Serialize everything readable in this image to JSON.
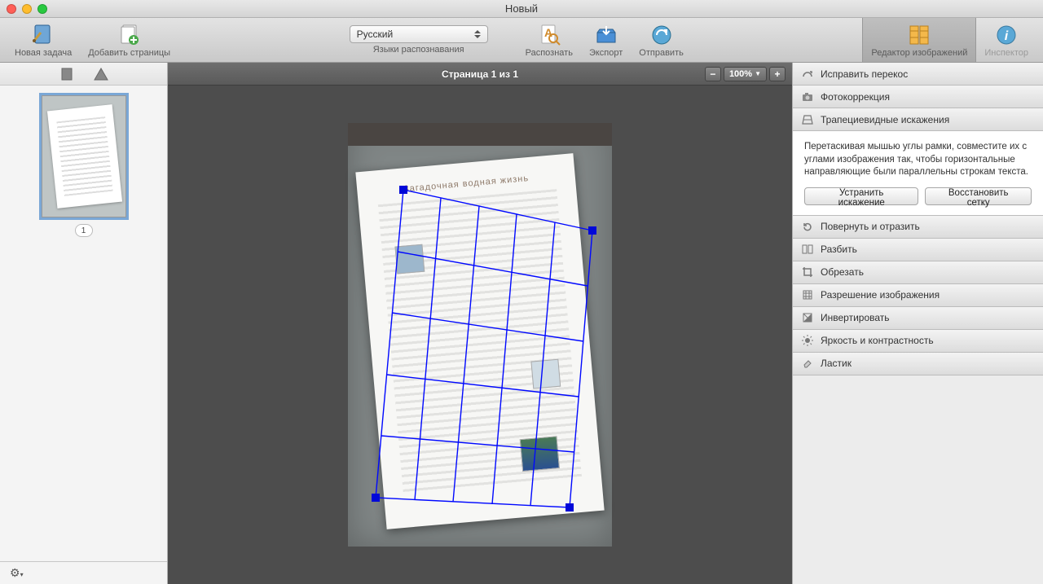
{
  "window": {
    "title": "Новый"
  },
  "toolbar": {
    "new_task": "Новая задача",
    "add_pages": "Добавить страницы",
    "lang_selected": "Русский",
    "lang_caption": "Языки распознавания",
    "recognize": "Распознать",
    "export": "Экспорт",
    "send": "Отправить",
    "image_editor": "Редактор изображений",
    "inspector": "Инспектор"
  },
  "thumb": {
    "number": "1"
  },
  "canvas": {
    "page_title": "Страница 1 из 1",
    "zoom": "100%",
    "minus": "−",
    "plus": "+",
    "doc_heading": "Загадочная водная жизнь"
  },
  "panel": {
    "deskew": "Исправить перекос",
    "photo_correction": "Фотокоррекция",
    "trapezoid": "Трапециевидные искажения",
    "trapezoid_help": "Перетаскивая мышью углы рамки, совместите их с углами изображения так, чтобы горизонтальные направляющие были параллельны строкам текста.",
    "fix_btn": "Устранить искажение",
    "reset_btn": "Восстановить сетку",
    "rotate": "Повернуть и отразить",
    "split": "Разбить",
    "crop": "Обрезать",
    "resolution": "Разрешение изображения",
    "invert": "Инвертировать",
    "brightness": "Яркость и контрастность",
    "eraser": "Ластик"
  }
}
